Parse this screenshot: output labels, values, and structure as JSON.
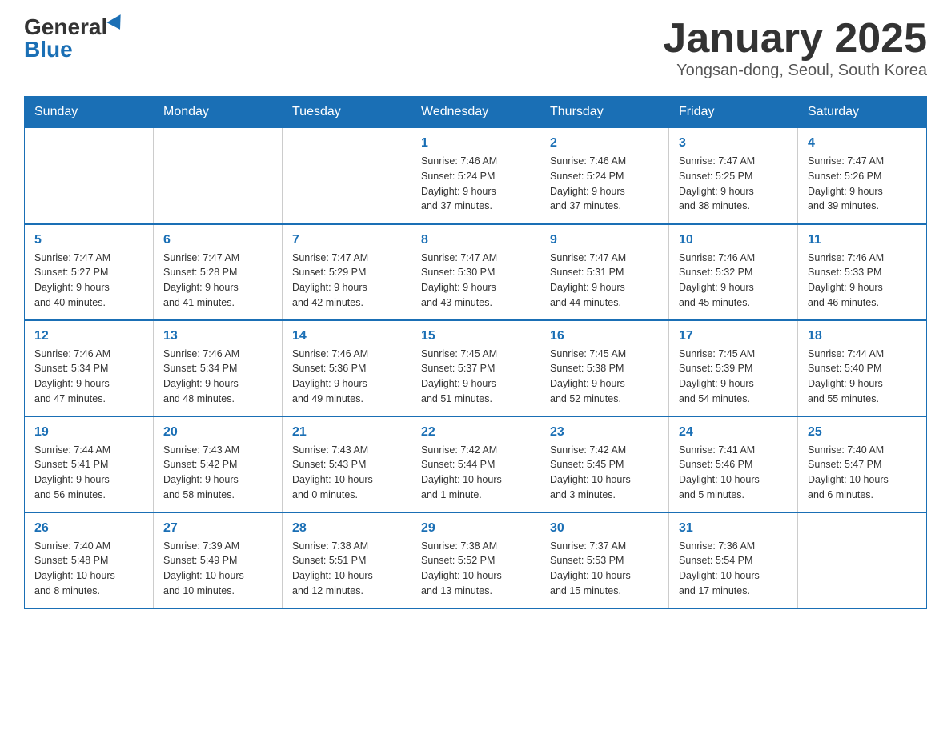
{
  "header": {
    "logo_general": "General",
    "logo_blue": "Blue",
    "month_title": "January 2025",
    "location": "Yongsan-dong, Seoul, South Korea"
  },
  "days_of_week": [
    "Sunday",
    "Monday",
    "Tuesday",
    "Wednesday",
    "Thursday",
    "Friday",
    "Saturday"
  ],
  "weeks": [
    [
      {
        "day": "",
        "info": ""
      },
      {
        "day": "",
        "info": ""
      },
      {
        "day": "",
        "info": ""
      },
      {
        "day": "1",
        "info": "Sunrise: 7:46 AM\nSunset: 5:24 PM\nDaylight: 9 hours\nand 37 minutes."
      },
      {
        "day": "2",
        "info": "Sunrise: 7:46 AM\nSunset: 5:24 PM\nDaylight: 9 hours\nand 37 minutes."
      },
      {
        "day": "3",
        "info": "Sunrise: 7:47 AM\nSunset: 5:25 PM\nDaylight: 9 hours\nand 38 minutes."
      },
      {
        "day": "4",
        "info": "Sunrise: 7:47 AM\nSunset: 5:26 PM\nDaylight: 9 hours\nand 39 minutes."
      }
    ],
    [
      {
        "day": "5",
        "info": "Sunrise: 7:47 AM\nSunset: 5:27 PM\nDaylight: 9 hours\nand 40 minutes."
      },
      {
        "day": "6",
        "info": "Sunrise: 7:47 AM\nSunset: 5:28 PM\nDaylight: 9 hours\nand 41 minutes."
      },
      {
        "day": "7",
        "info": "Sunrise: 7:47 AM\nSunset: 5:29 PM\nDaylight: 9 hours\nand 42 minutes."
      },
      {
        "day": "8",
        "info": "Sunrise: 7:47 AM\nSunset: 5:30 PM\nDaylight: 9 hours\nand 43 minutes."
      },
      {
        "day": "9",
        "info": "Sunrise: 7:47 AM\nSunset: 5:31 PM\nDaylight: 9 hours\nand 44 minutes."
      },
      {
        "day": "10",
        "info": "Sunrise: 7:46 AM\nSunset: 5:32 PM\nDaylight: 9 hours\nand 45 minutes."
      },
      {
        "day": "11",
        "info": "Sunrise: 7:46 AM\nSunset: 5:33 PM\nDaylight: 9 hours\nand 46 minutes."
      }
    ],
    [
      {
        "day": "12",
        "info": "Sunrise: 7:46 AM\nSunset: 5:34 PM\nDaylight: 9 hours\nand 47 minutes."
      },
      {
        "day": "13",
        "info": "Sunrise: 7:46 AM\nSunset: 5:34 PM\nDaylight: 9 hours\nand 48 minutes."
      },
      {
        "day": "14",
        "info": "Sunrise: 7:46 AM\nSunset: 5:36 PM\nDaylight: 9 hours\nand 49 minutes."
      },
      {
        "day": "15",
        "info": "Sunrise: 7:45 AM\nSunset: 5:37 PM\nDaylight: 9 hours\nand 51 minutes."
      },
      {
        "day": "16",
        "info": "Sunrise: 7:45 AM\nSunset: 5:38 PM\nDaylight: 9 hours\nand 52 minutes."
      },
      {
        "day": "17",
        "info": "Sunrise: 7:45 AM\nSunset: 5:39 PM\nDaylight: 9 hours\nand 54 minutes."
      },
      {
        "day": "18",
        "info": "Sunrise: 7:44 AM\nSunset: 5:40 PM\nDaylight: 9 hours\nand 55 minutes."
      }
    ],
    [
      {
        "day": "19",
        "info": "Sunrise: 7:44 AM\nSunset: 5:41 PM\nDaylight: 9 hours\nand 56 minutes."
      },
      {
        "day": "20",
        "info": "Sunrise: 7:43 AM\nSunset: 5:42 PM\nDaylight: 9 hours\nand 58 minutes."
      },
      {
        "day": "21",
        "info": "Sunrise: 7:43 AM\nSunset: 5:43 PM\nDaylight: 10 hours\nand 0 minutes."
      },
      {
        "day": "22",
        "info": "Sunrise: 7:42 AM\nSunset: 5:44 PM\nDaylight: 10 hours\nand 1 minute."
      },
      {
        "day": "23",
        "info": "Sunrise: 7:42 AM\nSunset: 5:45 PM\nDaylight: 10 hours\nand 3 minutes."
      },
      {
        "day": "24",
        "info": "Sunrise: 7:41 AM\nSunset: 5:46 PM\nDaylight: 10 hours\nand 5 minutes."
      },
      {
        "day": "25",
        "info": "Sunrise: 7:40 AM\nSunset: 5:47 PM\nDaylight: 10 hours\nand 6 minutes."
      }
    ],
    [
      {
        "day": "26",
        "info": "Sunrise: 7:40 AM\nSunset: 5:48 PM\nDaylight: 10 hours\nand 8 minutes."
      },
      {
        "day": "27",
        "info": "Sunrise: 7:39 AM\nSunset: 5:49 PM\nDaylight: 10 hours\nand 10 minutes."
      },
      {
        "day": "28",
        "info": "Sunrise: 7:38 AM\nSunset: 5:51 PM\nDaylight: 10 hours\nand 12 minutes."
      },
      {
        "day": "29",
        "info": "Sunrise: 7:38 AM\nSunset: 5:52 PM\nDaylight: 10 hours\nand 13 minutes."
      },
      {
        "day": "30",
        "info": "Sunrise: 7:37 AM\nSunset: 5:53 PM\nDaylight: 10 hours\nand 15 minutes."
      },
      {
        "day": "31",
        "info": "Sunrise: 7:36 AM\nSunset: 5:54 PM\nDaylight: 10 hours\nand 17 minutes."
      },
      {
        "day": "",
        "info": ""
      }
    ]
  ]
}
